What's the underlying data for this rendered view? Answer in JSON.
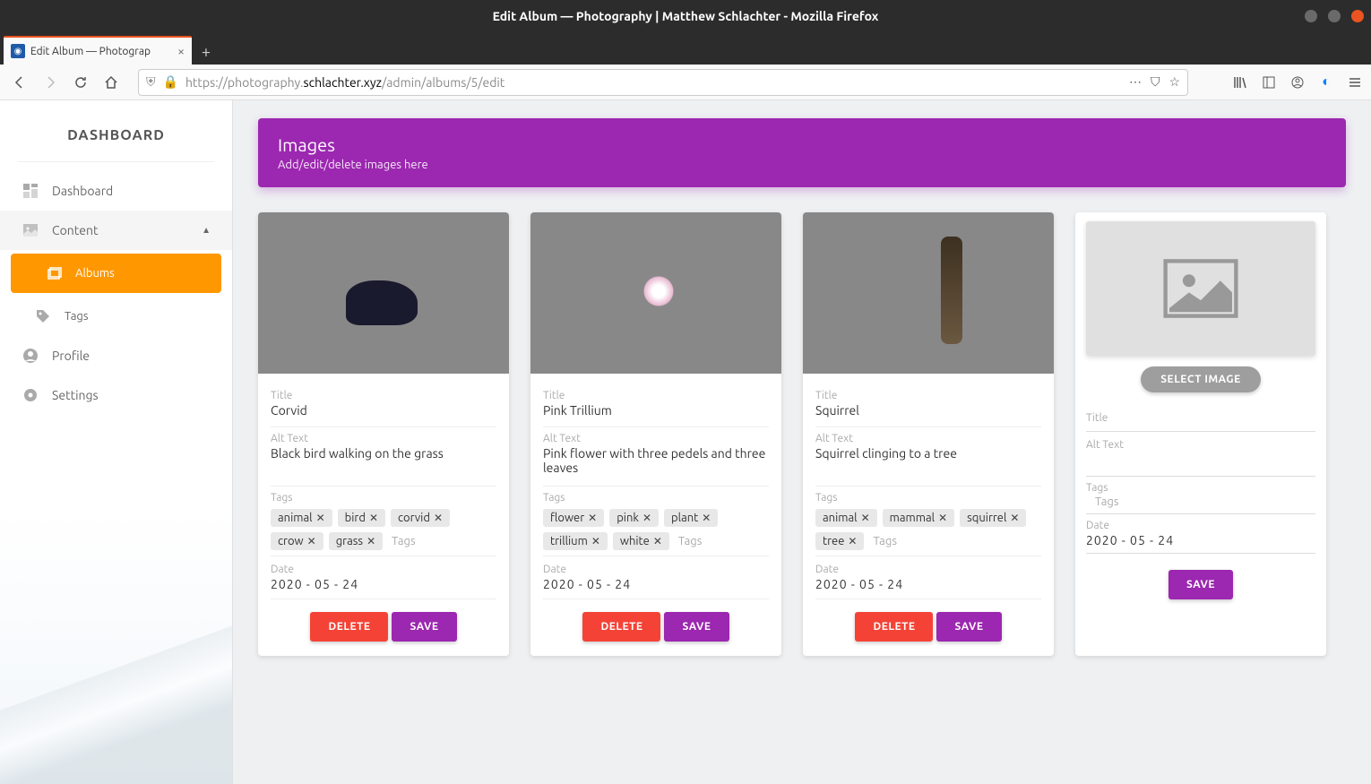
{
  "window": {
    "title": "Edit Album — Photography | Matthew Schlachter - Mozilla Firefox"
  },
  "tab": {
    "title": "Edit Album — Photograp"
  },
  "url": {
    "protocol": "https://",
    "sub": "photography.",
    "domain": "schlachter.xyz",
    "path": "/admin/albums/5/edit"
  },
  "sidebar": {
    "title": "DASHBOARD",
    "items": {
      "dashboard": "Dashboard",
      "content": "Content",
      "albums": "Albums",
      "tags": "Tags",
      "profile": "Profile",
      "settings": "Settings"
    }
  },
  "banner": {
    "title": "Images",
    "subtitle": "Add/edit/delete images here"
  },
  "labels": {
    "title": "Title",
    "alt": "Alt Text",
    "tags": "Tags",
    "tagsHint": "Tags",
    "date": "Date",
    "delete": "DELETE",
    "save": "SAVE",
    "selectImage": "SELECT IMAGE"
  },
  "cards": [
    {
      "title": "Corvid",
      "alt": "Black bird walking on the grass",
      "tags": [
        "animal",
        "bird",
        "corvid",
        "crow",
        "grass"
      ],
      "date": "2020 - 05 - 24"
    },
    {
      "title": "Pink Trillium",
      "alt": "Pink flower with three pedels and three leaves",
      "tags": [
        "flower",
        "pink",
        "plant",
        "trillium",
        "white"
      ],
      "date": "2020 - 05 - 24"
    },
    {
      "title": "Squirrel",
      "alt": "Squirrel clinging to a tree",
      "tags": [
        "animal",
        "mammal",
        "squirrel",
        "tree"
      ],
      "date": "2020 - 05 - 24"
    }
  ],
  "newCard": {
    "date": "2020 - 05 - 24"
  }
}
